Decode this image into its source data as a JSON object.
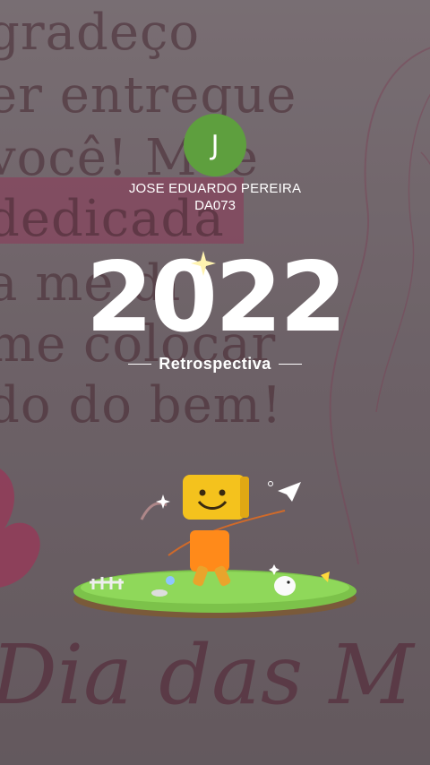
{
  "background": {
    "lines": [
      "gradeço",
      "er entregue",
      "você! Mãe",
      "dedicada",
      "a me di",
      "me colocar",
      "do do bem!"
    ],
    "script_text": "Dia das M"
  },
  "profile": {
    "avatar_letter": "J",
    "name": "JOSE EDUARDO PEREIRA",
    "id": "DA073"
  },
  "recap": {
    "year": "2022",
    "subtitle": "Retrospectiva"
  },
  "colors": {
    "avatar_bg": "#5e9f3e",
    "highlight": "#a63a63"
  },
  "icons": [
    "sparkle-icon",
    "paper-plane-icon",
    "character-illustration"
  ]
}
